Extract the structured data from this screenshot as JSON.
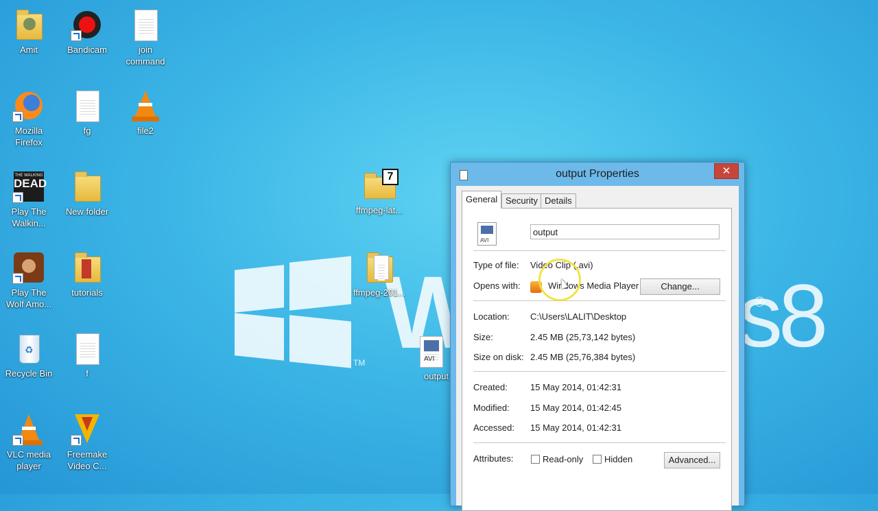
{
  "wallpaper": {
    "watermark_w": "W",
    "watermark_s": "s",
    "watermark_8": "8",
    "trademark": "TM",
    "registered": "®"
  },
  "desktop_icons": [
    {
      "id": "amit",
      "label": "Amit"
    },
    {
      "id": "bandicam",
      "label": "Bandicam"
    },
    {
      "id": "join",
      "label": "join\ncommand"
    },
    {
      "id": "firefox",
      "label": "Mozilla\nFirefox"
    },
    {
      "id": "fg",
      "label": "fg"
    },
    {
      "id": "file2",
      "label": "file2"
    },
    {
      "id": "walkingdead",
      "label": "Play The\nWalkin...",
      "art": "DEAD",
      "art_top": "THE WALKING"
    },
    {
      "id": "newfolder",
      "label": "New folder"
    },
    {
      "id": "ffmpeglat",
      "label": "ffmpeg-lat...",
      "badge": "7"
    },
    {
      "id": "wolf",
      "label": "Play The\nWolf Amo..."
    },
    {
      "id": "tutorials",
      "label": "tutorials"
    },
    {
      "id": "ffmpeg201",
      "label": "ffmpeg-201..."
    },
    {
      "id": "recycle",
      "label": "Recycle Bin"
    },
    {
      "id": "f",
      "label": "f"
    },
    {
      "id": "outputfile",
      "label": "output",
      "tag": "AVI"
    },
    {
      "id": "vlc",
      "label": "VLC media\nplayer"
    },
    {
      "id": "freemake",
      "label": "Freemake\nVideo C..."
    }
  ],
  "dialog": {
    "title": "output Properties",
    "close_glyph": "✕",
    "tabs": [
      "General",
      "Security",
      "Details"
    ],
    "file_icon_tag": "AVI",
    "name_value": "output",
    "rows": {
      "type_label": "Type of file:",
      "type_value": "Video Clip (.avi)",
      "opens_label": "Opens with:",
      "opens_value": "Windows Media Player",
      "change_btn": "Change...",
      "location_label": "Location:",
      "location_value": "C:\\Users\\LALIT\\Desktop",
      "size_label": "Size:",
      "size_value": "2.45 MB (25,73,142 bytes)",
      "disk_label": "Size on disk:",
      "disk_value": "2.45 MB (25,76,384 bytes)",
      "created_label": "Created:",
      "created_value": "15 May 2014, 01:42:31",
      "modified_label": "Modified:",
      "modified_value": "15 May 2014, 01:42:45",
      "accessed_label": "Accessed:",
      "accessed_value": "15 May 2014, 01:42:31",
      "attr_label": "Attributes:",
      "readonly_label": "Read-only",
      "hidden_label": "Hidden",
      "advanced_btn": "Advanced..."
    }
  },
  "colors": {
    "accent": "#6db9ea",
    "close": "#c7463a",
    "highlight_ring": "#f0e13c"
  }
}
